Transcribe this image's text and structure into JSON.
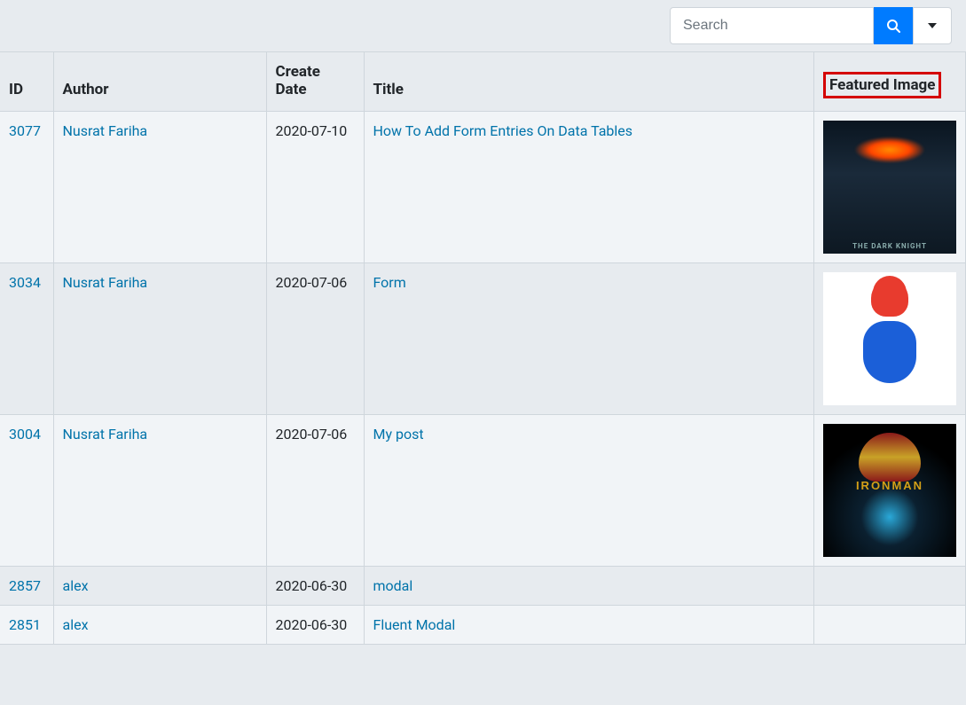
{
  "search": {
    "placeholder": "Search"
  },
  "columns": {
    "id": "ID",
    "author": "Author",
    "date": "Create Date",
    "title": "Title",
    "image": "Featured Image"
  },
  "rows": [
    {
      "id": "3077",
      "author": "Nusrat Fariha",
      "date": "2020-07-10",
      "title": "How To Add Form Entries On Data Tables",
      "image_class": "thumb-dark-knight",
      "image_alt": "The Dark Knight poster"
    },
    {
      "id": "3034",
      "author": "Nusrat Fariha",
      "date": "2020-07-06",
      "title": "Form",
      "image_class": "thumb-mario",
      "image_alt": "Mario character"
    },
    {
      "id": "3004",
      "author": "Nusrat Fariha",
      "date": "2020-07-06",
      "title": "My post",
      "image_class": "thumb-ironman",
      "image_alt": "Iron Man poster"
    },
    {
      "id": "2857",
      "author": "alex",
      "date": "2020-06-30",
      "title": "modal",
      "image_class": "thumb-empty",
      "image_alt": ""
    },
    {
      "id": "2851",
      "author": "alex",
      "date": "2020-06-30",
      "title": "Fluent Modal",
      "image_class": "thumb-empty",
      "image_alt": ""
    }
  ]
}
